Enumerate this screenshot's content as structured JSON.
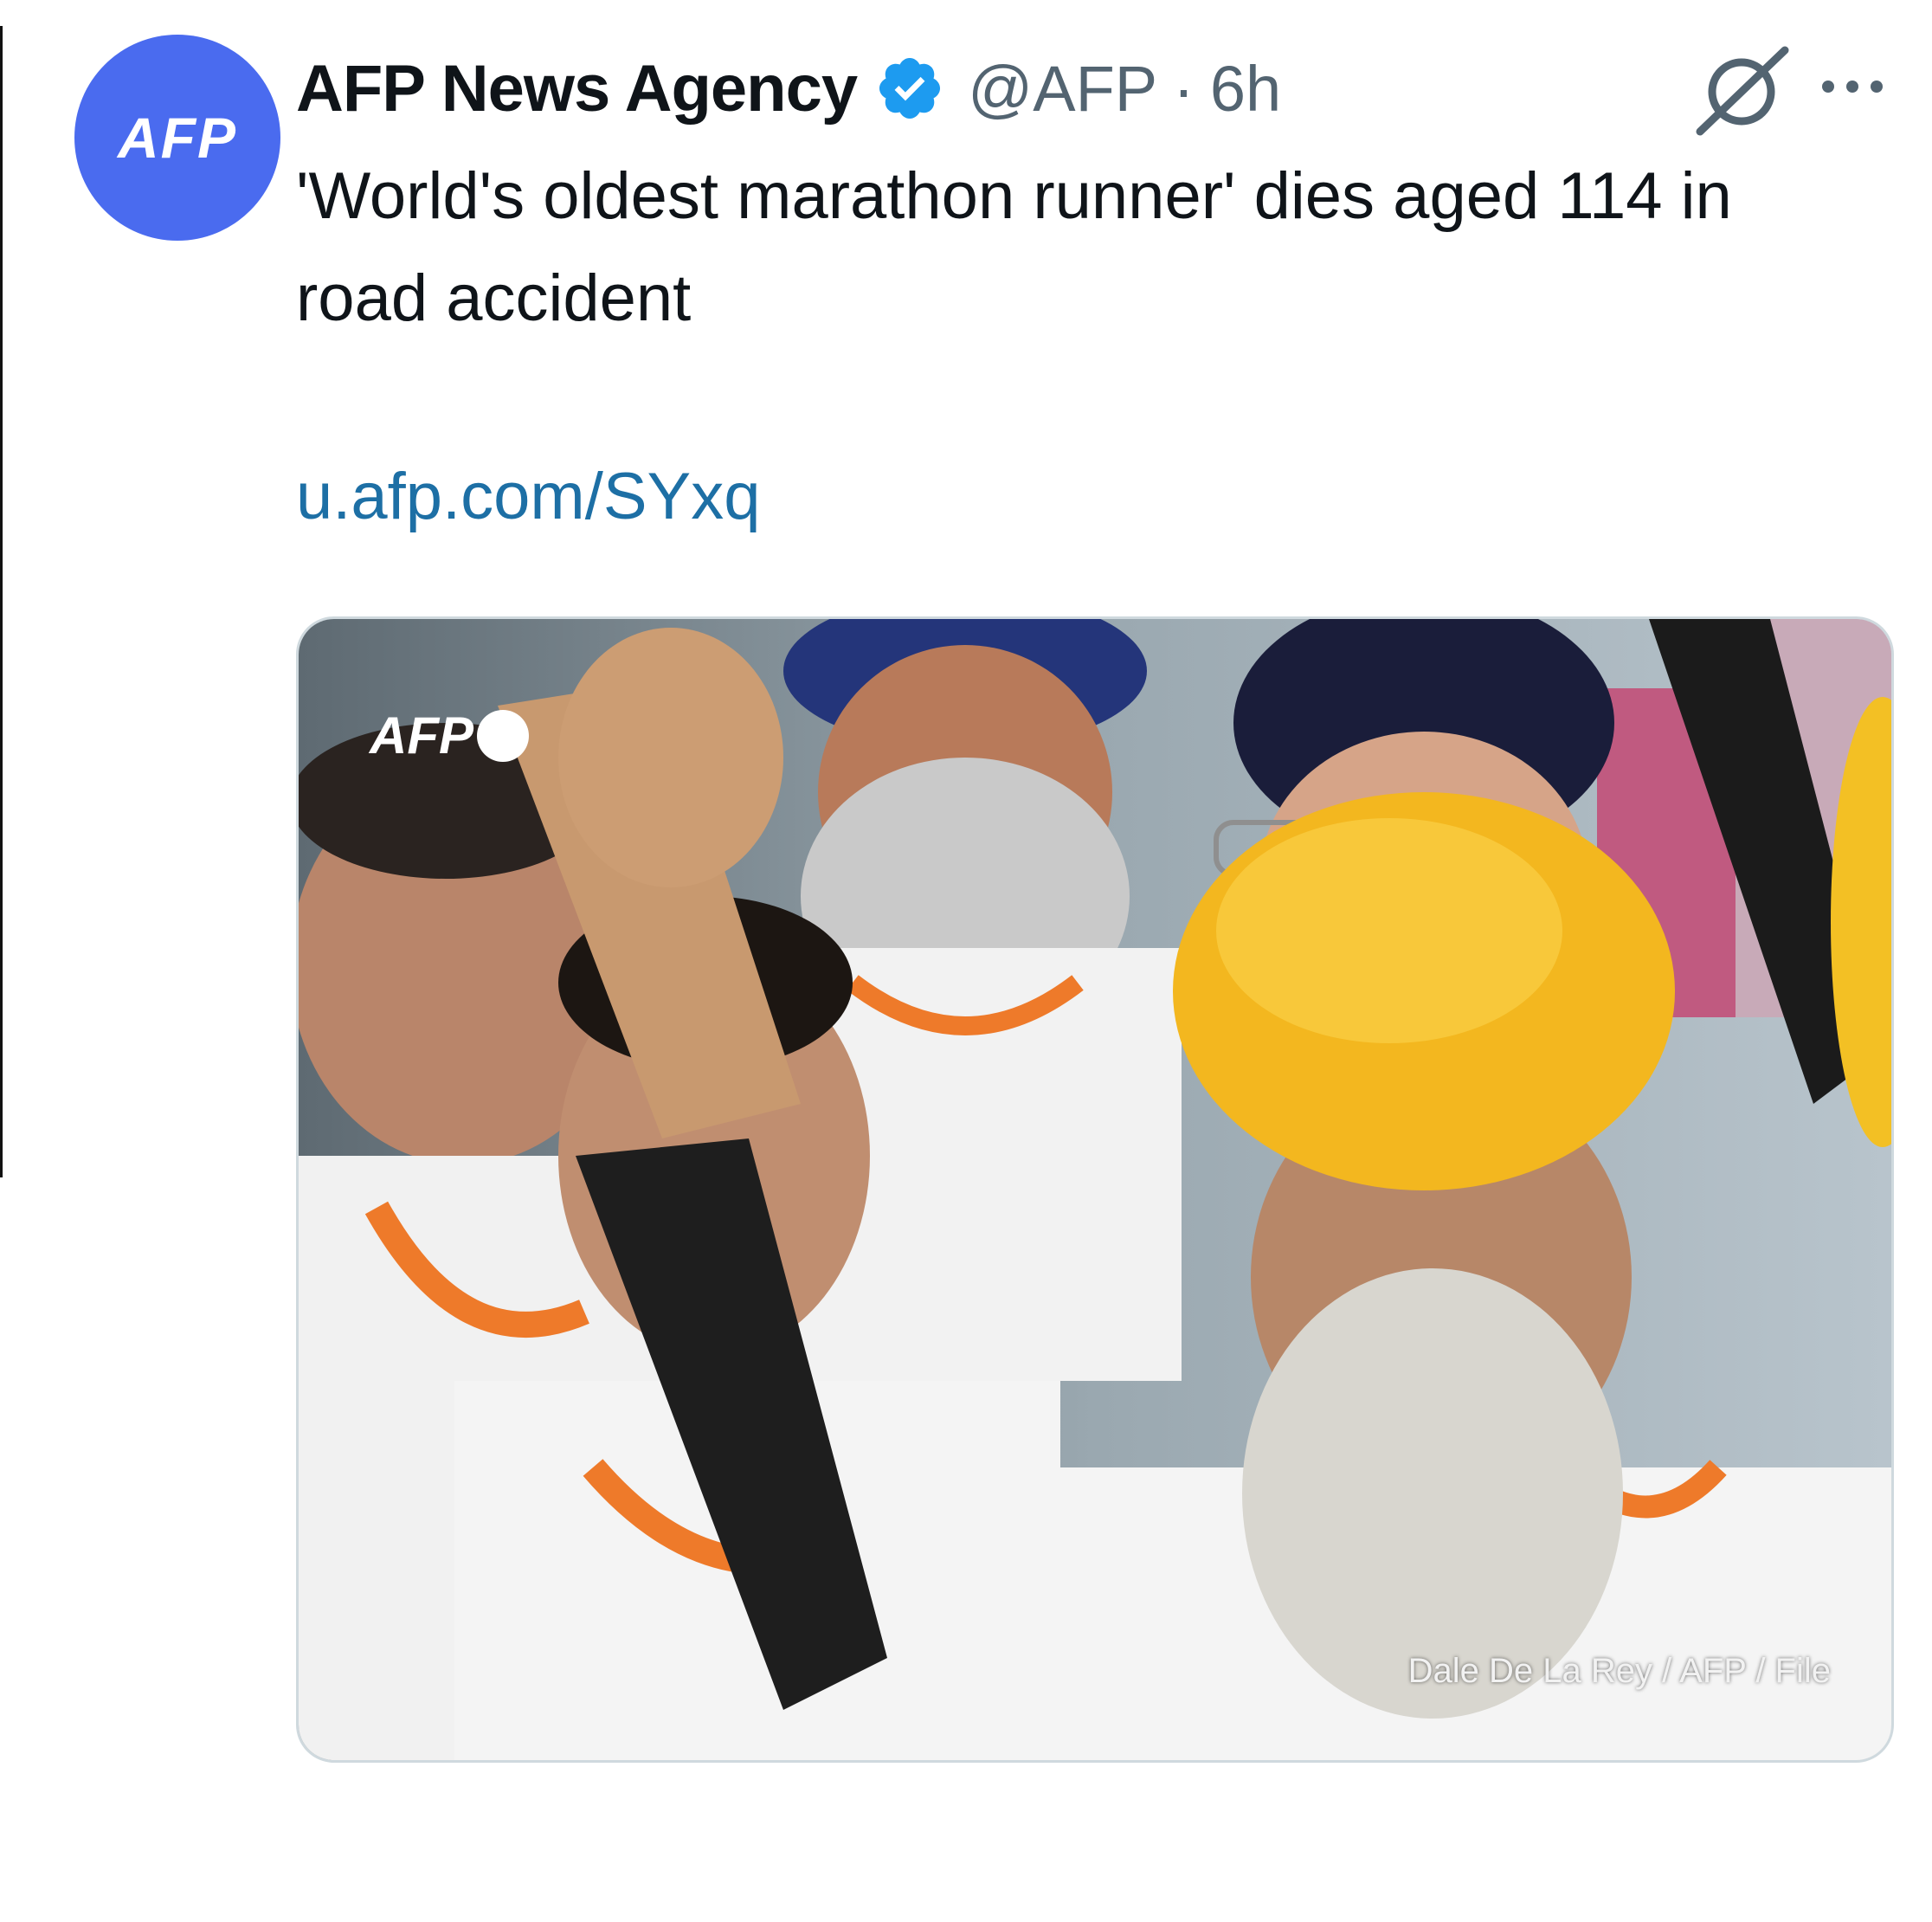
{
  "tweet": {
    "avatar_text": "AFP",
    "display_name": "AFP News Agency",
    "handle": "@AFP",
    "separator": "·",
    "time": "6h",
    "text": "'World's oldest marathon runner' dies aged 114 in road accident",
    "link": "u.afp.com/SYxq",
    "media": {
      "watermark": "AFP",
      "credit": "Dale De La Rey / AFP / File"
    }
  },
  "colors": {
    "avatar_bg": "#4a6bef",
    "verified": "#1d9bf0",
    "link": "#1d6fa5",
    "secondary_text": "#536471"
  },
  "icons": {
    "verified": "verified-badge-icon",
    "grok": "grok-icon",
    "more": "more-horizontal-icon"
  }
}
